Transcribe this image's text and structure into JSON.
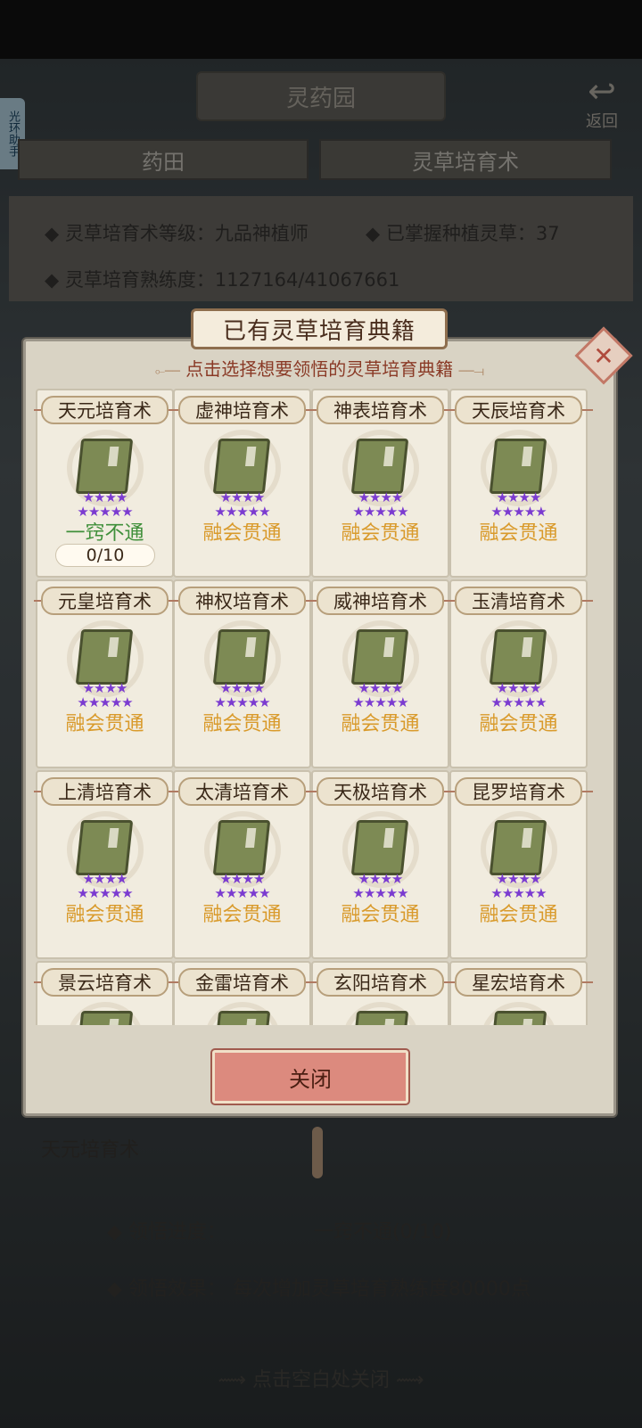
{
  "background": {
    "title": "灵药园",
    "back_label": "返回",
    "helper_label": "光环助手",
    "tabs": [
      "药田",
      "灵草培育术"
    ],
    "info": {
      "level_label": "灵草培育术等级：",
      "level_value": "九品神植师",
      "mastered_label": "已掌握种植灵草：",
      "mastered_value": "37",
      "proficiency_label": "灵草培育熟练度：",
      "proficiency_value": "1127164/41067661"
    },
    "selected_name": "天元培育术",
    "progress_label": "领悟进度：",
    "progress_value": "一窍不通(0/10)",
    "effect_label": "领悟效果：",
    "effect_value": "每次增加灵草培育熟练度80000点",
    "close_hint": "点击空白处关闭"
  },
  "modal": {
    "title": "已有灵草培育典籍",
    "subtitle": "点击选择想要领悟的灵草培育典籍",
    "close_icon": "close-x-icon",
    "close_button": "关闭",
    "star_color": "#7b3bd0",
    "books": [
      {
        "name": "天元培育术",
        "level": "一窍不通",
        "progress": "0/10"
      },
      {
        "name": "虚神培育术",
        "level": "融会贯通"
      },
      {
        "name": "神表培育术",
        "level": "融会贯通"
      },
      {
        "name": "天辰培育术",
        "level": "融会贯通"
      },
      {
        "name": "元皇培育术",
        "level": "融会贯通"
      },
      {
        "name": "神权培育术",
        "level": "融会贯通"
      },
      {
        "name": "威神培育术",
        "level": "融会贯通"
      },
      {
        "name": "玉清培育术",
        "level": "融会贯通"
      },
      {
        "name": "上清培育术",
        "level": "融会贯通"
      },
      {
        "name": "太清培育术",
        "level": "融会贯通"
      },
      {
        "name": "天极培育术",
        "level": "融会贯通"
      },
      {
        "name": "昆罗培育术",
        "level": "融会贯通"
      },
      {
        "name": "景云培育术"
      },
      {
        "name": "金雷培育术"
      },
      {
        "name": "玄阳培育术"
      },
      {
        "name": "星宏培育术"
      }
    ]
  }
}
